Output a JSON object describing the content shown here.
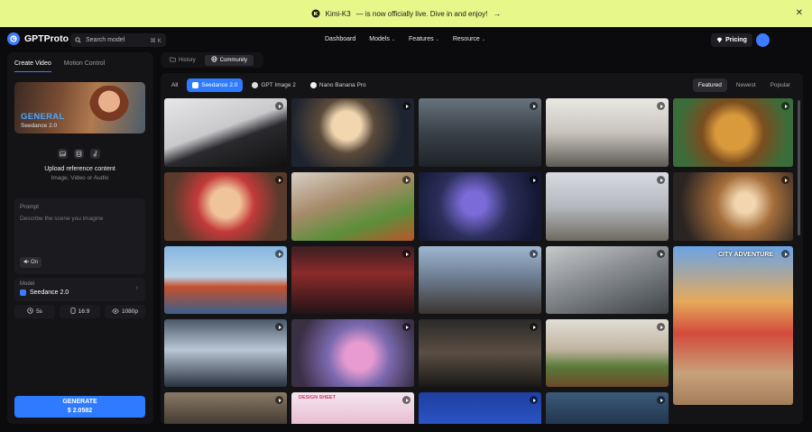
{
  "banner": {
    "brand": "Kimi-K3",
    "message": "— is now officially live. Dive in and enjoy!",
    "arrow": "→",
    "close": "✕"
  },
  "nav": {
    "logo": "GPTProto",
    "search_placeholder": "Search model",
    "search_shortcut": "⌘ K",
    "menu": [
      {
        "label": "Dashboard",
        "chevron": ""
      },
      {
        "label": "Models",
        "chevron": "⌄"
      },
      {
        "label": "Features",
        "chevron": "⌄"
      },
      {
        "label": "Resource",
        "chevron": "⌄"
      }
    ],
    "pricing": "Pricing"
  },
  "left": {
    "tabs": [
      "Create Video",
      "Motion Control"
    ],
    "hero_title": "GENERAL",
    "hero_sub": "Seedance 2.0",
    "upload_title": "Upload reference content",
    "upload_sub": "Image, Video or Audio",
    "prompt_label": "Prompt",
    "prompt_placeholder": "Describe the scene you imagine",
    "sound": "On",
    "model_label": "Model",
    "model_value": "Seedance 2.0",
    "model_chevron": "›",
    "options": [
      "5s",
      "16:9",
      "1080p"
    ],
    "generate_label": "GENERATE",
    "generate_price": "$ 2.0582"
  },
  "topbar": {
    "tabs": [
      "History",
      "Community"
    ]
  },
  "main": {
    "filters": [
      "All",
      "Seedance 2.0",
      "GPT Image 2",
      "Nano Banana Pro"
    ],
    "sorts": [
      "Featured",
      "Newest",
      "Popular"
    ],
    "city_title": "CITY ADVENTURE",
    "comic_text": "DESIGN SHEET"
  },
  "colors": {
    "accent": "#2f7bff",
    "banner_bg": "#e8f78a",
    "page_bg": "#0b0b0d",
    "panel_bg": "#141417"
  }
}
